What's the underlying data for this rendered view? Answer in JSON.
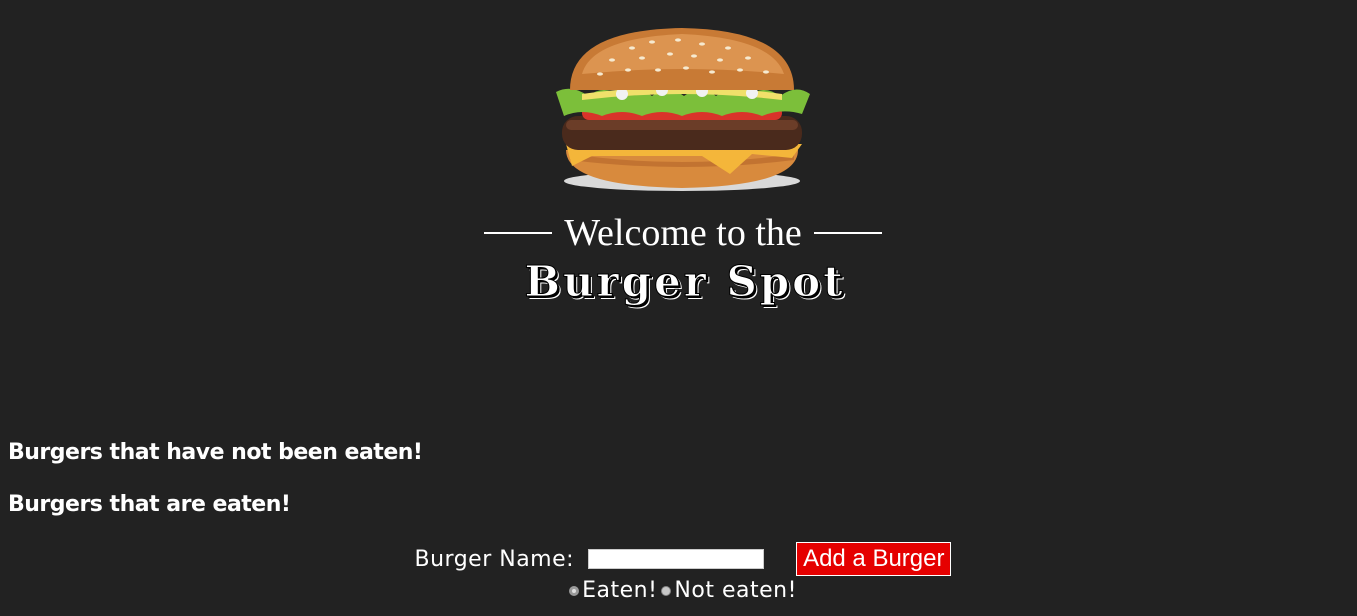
{
  "hero": {
    "image_name": "burger-illustration",
    "welcome_text": "Welcome to the",
    "brand_title": "Burger Spot"
  },
  "sections": {
    "uneaten_heading": "Burgers that have not been eaten!",
    "eaten_heading": "Burgers that are eaten!"
  },
  "form": {
    "name_label": "Burger Name:",
    "name_value": "",
    "add_button_label": "Add a Burger",
    "radio_options": [
      {
        "label": "Eaten!",
        "selected": true
      },
      {
        "label": "Not eaten!",
        "selected": false
      }
    ]
  },
  "colors": {
    "background": "#222222",
    "text": "#ffffff",
    "button": "#e50000"
  }
}
